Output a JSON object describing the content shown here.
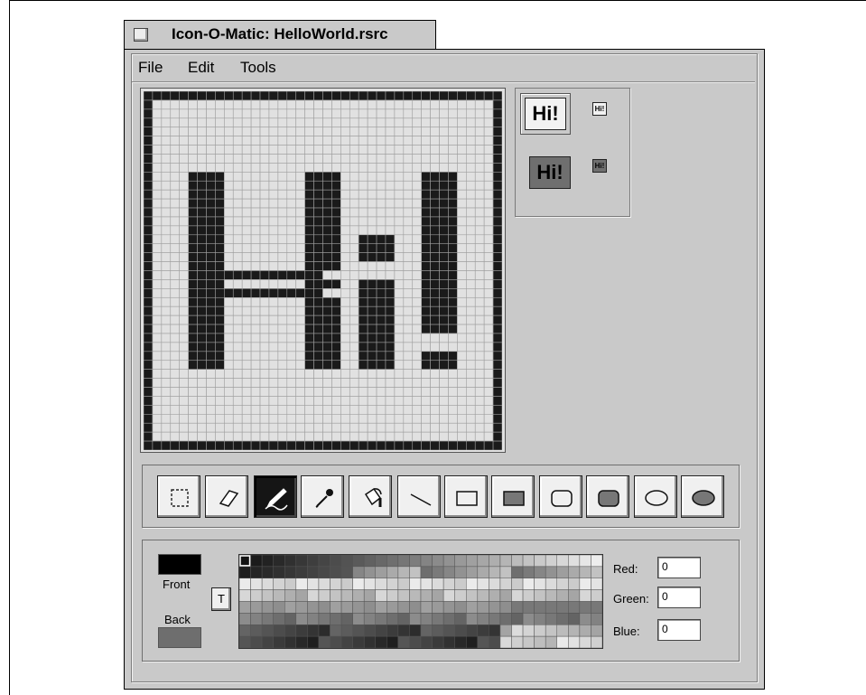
{
  "window": {
    "title": "Icon-O-Matic: HelloWorld.rsrc"
  },
  "menu": {
    "items": [
      "File",
      "Edit",
      "Tools"
    ]
  },
  "editor": {
    "grid_size": 40,
    "background_color": "#e1e1e1",
    "pixel_color": "#1a1a1a",
    "grid_line_color": "#9e9e9e",
    "rows": [
      "########################################",
      "#......................................#",
      "#......................................#",
      "#......................................#",
      "#......................................#",
      "#......................................#",
      "#......................................#",
      "#......................................#",
      "#......................................#",
      "#....####.........####.........####....#",
      "#....####.........####.........####....#",
      "#....####.........####.........####....#",
      "#....####.........####.........####....#",
      "#....####.........####.........####....#",
      "#....####.........####.........####....#",
      "#....####.........####.........####....#",
      "#....####.........####..####...####....#",
      "#....####.........####..####...####....#",
      "#....####.........####..####...####....#",
      "#....####.........####.........####....#",
      "#....###############...........####....#",
      "#....####.........####..####...####....#",
      "#....###############....####...####....#",
      "#....####.........####..####...####....#",
      "#....####.........####..####...####....#",
      "#....####.........####..####...####....#",
      "#....####.........####..####...####....#",
      "#....####.........####..####...........#",
      "#....####.........####..####...........#",
      "#....####.........####..####...####....#",
      "#....####.........####..####...####....#",
      "#......................................#",
      "#......................................#",
      "#......................................#",
      "#......................................#",
      "#......................................#",
      "#......................................#",
      "#......................................#",
      "#......................................#",
      "########################################"
    ]
  },
  "preview": {
    "large_text": "Hi!",
    "small_text": "Hi!",
    "normal_bg": "#f2f2f2",
    "selected_bg": "#6f6f6f"
  },
  "tools": [
    {
      "name": "select-tool",
      "icon": "dashed-square-icon",
      "selected": false
    },
    {
      "name": "eraser-tool",
      "icon": "eraser-icon",
      "selected": false
    },
    {
      "name": "pencil-tool",
      "icon": "pencil-icon",
      "selected": true
    },
    {
      "name": "eyedropper-tool",
      "icon": "eyedropper-icon",
      "selected": false
    },
    {
      "name": "fill-tool",
      "icon": "paint-bucket-icon",
      "selected": false
    },
    {
      "name": "line-tool",
      "icon": "line-icon",
      "selected": false
    },
    {
      "name": "rectangle-tool",
      "icon": "rectangle-icon",
      "selected": false
    },
    {
      "name": "filled-rectangle-tool",
      "icon": "filled-rectangle-icon",
      "selected": false
    },
    {
      "name": "rounded-rectangle-tool",
      "icon": "rounded-rectangle-icon",
      "selected": false
    },
    {
      "name": "filled-rounded-rectangle-tool",
      "icon": "filled-rounded-rectangle-icon",
      "selected": false
    },
    {
      "name": "ellipse-tool",
      "icon": "ellipse-icon",
      "selected": false
    },
    {
      "name": "filled-ellipse-tool",
      "icon": "filled-ellipse-icon",
      "selected": false
    }
  ],
  "colors": {
    "front_label": "Front",
    "back_label": "Back",
    "front_color": "#000000",
    "back_color": "#6e6e6e",
    "swap_label": "T",
    "red_label": "Red:",
    "green_label": "Green:",
    "blue_label": "Blue:",
    "red_value": "0",
    "green_value": "0",
    "blue_value": "0",
    "palette_columns": 32,
    "palette_rows": 8
  }
}
